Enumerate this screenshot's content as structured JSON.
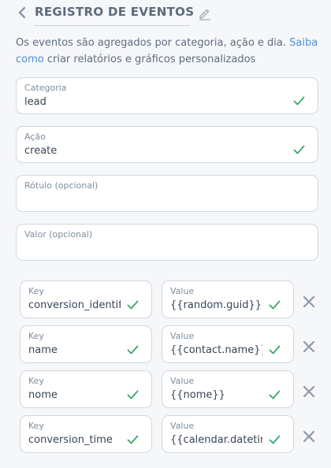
{
  "header": {
    "title": "REGISTRO DE EVENTOS",
    "back_icon": "chevron-left-icon",
    "edit_icon": "pencil-icon"
  },
  "description": {
    "text_before": "Os eventos são agregados por categoria, ação e dia. ",
    "link": "Saiba como",
    "text_after": " criar relatórios e gráficos personalizados"
  },
  "fields": {
    "category": {
      "label": "Categoria",
      "value": "lead"
    },
    "action": {
      "label": "Ação",
      "value": "create"
    },
    "label_optional": {
      "label": "Rótulo (opcional)",
      "value": ""
    },
    "value_optional": {
      "label": "Valor (opcional)",
      "value": ""
    }
  },
  "extras": [
    {
      "key_label": "Key",
      "key": "conversion_identifier",
      "value_label": "Value",
      "value": "{{random.guid}}"
    },
    {
      "key_label": "Key",
      "key": "name",
      "value_label": "Value",
      "value": "{{contact.name}}"
    },
    {
      "key_label": "Key",
      "key": "nome",
      "value_label": "Value",
      "value": "{{nome}}"
    },
    {
      "key_label": "Key",
      "key": "conversion_time",
      "value_label": "Value",
      "value": "{{calendar.datetime}}"
    }
  ],
  "colors": {
    "accent": "#4f8fd6",
    "valid": "#3aa76d",
    "border": "#cfd8e0",
    "remove": "#8c9aa8"
  }
}
